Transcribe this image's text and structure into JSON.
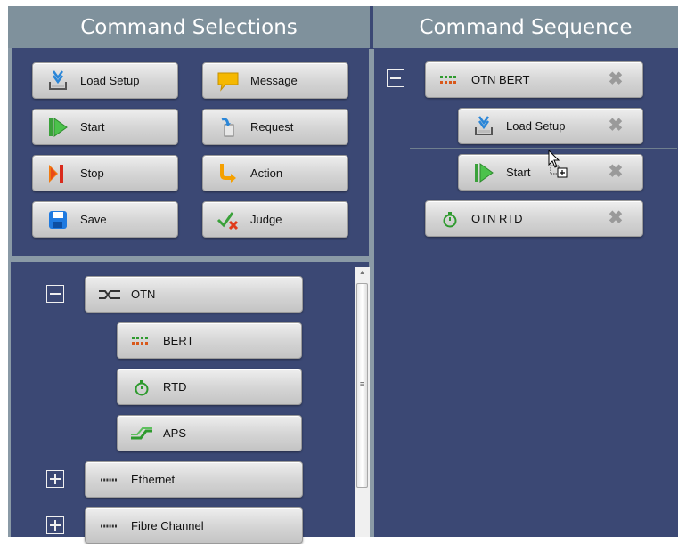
{
  "headers": {
    "command_selections": "Command Selections",
    "command_sequence": "Command Sequence"
  },
  "commands": [
    {
      "label": "Load Setup",
      "icon": "load-setup-icon"
    },
    {
      "label": "Message",
      "icon": "message-icon"
    },
    {
      "label": "Start",
      "icon": "start-icon"
    },
    {
      "label": "Request",
      "icon": "request-icon"
    },
    {
      "label": "Stop",
      "icon": "stop-icon"
    },
    {
      "label": "Action",
      "icon": "action-icon"
    },
    {
      "label": "Save",
      "icon": "save-icon"
    },
    {
      "label": "Judge",
      "icon": "judge-icon"
    }
  ],
  "tree": {
    "otn": "OTN",
    "bert": "BERT",
    "rtd": "RTD",
    "aps": "APS",
    "ethernet": "Ethernet",
    "fibre_channel": "Fibre Channel"
  },
  "sequence": {
    "otn_bert": "OTN BERT",
    "load_setup": "Load Setup",
    "start": "Start",
    "otn_rtd": "OTN RTD"
  },
  "colors": {
    "panel_bg": "#3b4874",
    "header_bg": "#7f919c",
    "divider": "#8a9aa6"
  }
}
